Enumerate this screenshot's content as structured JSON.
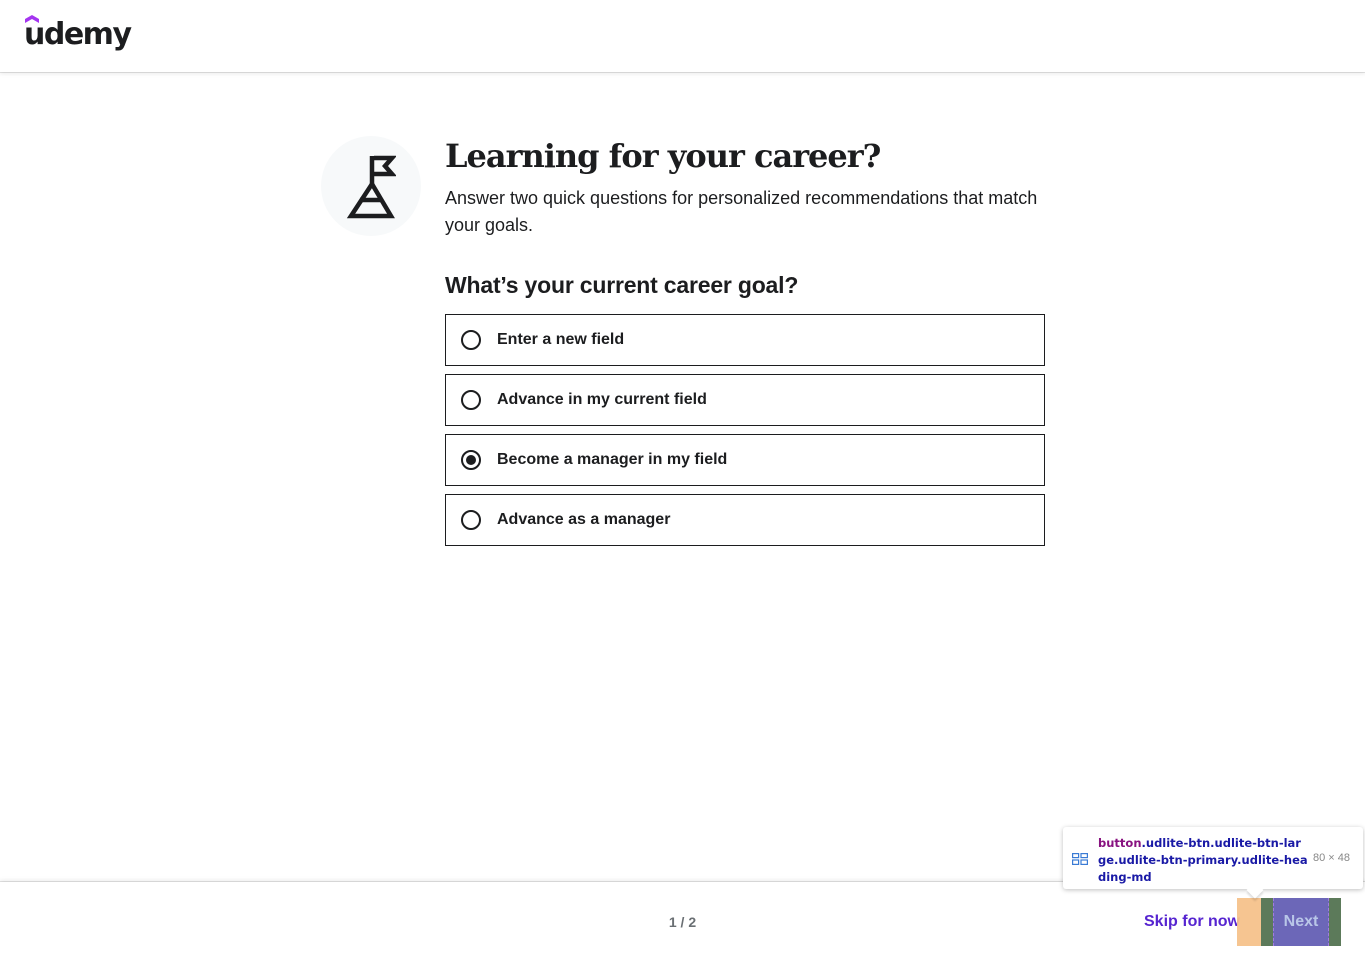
{
  "header": {
    "logo_text": "udemy"
  },
  "colors": {
    "brand_purple": "#a435f0",
    "text": "#1c1d1f",
    "link": "#5624d0"
  },
  "intro": {
    "icon": "mountain-flag-icon",
    "title": "Learning for your career?",
    "subtitle": "Answer two quick questions for personalized recommendations that match your goals."
  },
  "question": {
    "label": "What’s your current career goal?",
    "options": [
      {
        "label": "Enter a new field",
        "checked": false
      },
      {
        "label": "Advance in my current field",
        "checked": false
      },
      {
        "label": "Become a manager in my field",
        "checked": true
      },
      {
        "label": "Advance as a manager",
        "checked": false
      }
    ]
  },
  "footer": {
    "page_indicator": "1 / 2",
    "skip_label": "Skip for now",
    "next_label": "Next"
  },
  "devtools_tooltip": {
    "tag": "button",
    "classes": ".udlite-btn.udlite-btn-large.udlite-btn-primary.udlite-heading-md",
    "dimensions": "80 × 48"
  }
}
